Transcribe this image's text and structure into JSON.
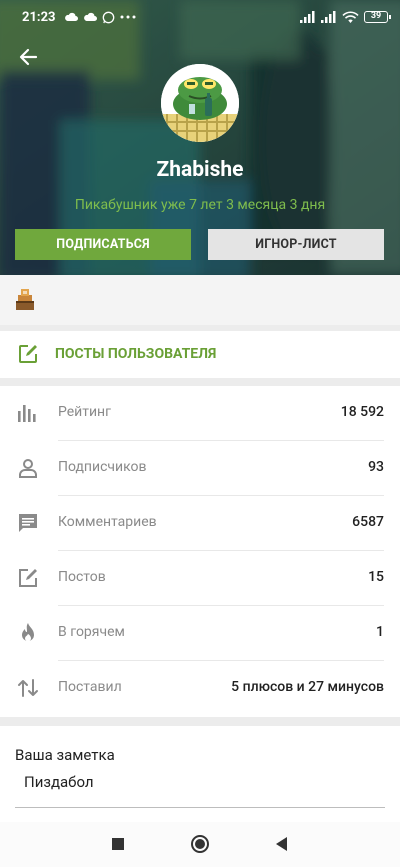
{
  "status_bar": {
    "time": "21:23",
    "battery": "39"
  },
  "profile": {
    "username": "Zhabishe",
    "since": "Пикабушник уже 7 лет 3 месяца 3 дня",
    "subscribe_label": "ПОДПИСАТЬСЯ",
    "ignore_label": "ИГНОР-ЛИСТ"
  },
  "posts_link": {
    "label": "ПОСТЫ ПОЛЬЗОВАТЕЛЯ"
  },
  "stats": [
    {
      "icon": "bar-chart-icon",
      "label": "Рейтинг",
      "value": "18 592"
    },
    {
      "icon": "person-icon",
      "label": "Подписчиков",
      "value": "93"
    },
    {
      "icon": "comment-icon",
      "label": "Комментариев",
      "value": "6587"
    },
    {
      "icon": "edit-icon",
      "label": "Постов",
      "value": "15"
    },
    {
      "icon": "fire-icon",
      "label": "В горячем",
      "value": "1"
    },
    {
      "icon": "sort-arrows-icon",
      "label": "Поставил",
      "value": "5 плюсов и 27 минусов"
    }
  ],
  "note": {
    "title": "Ваша заметка",
    "text": "Пиздабол"
  },
  "colors": {
    "accent_green": "#70a83d",
    "link_green": "#6aa036"
  }
}
